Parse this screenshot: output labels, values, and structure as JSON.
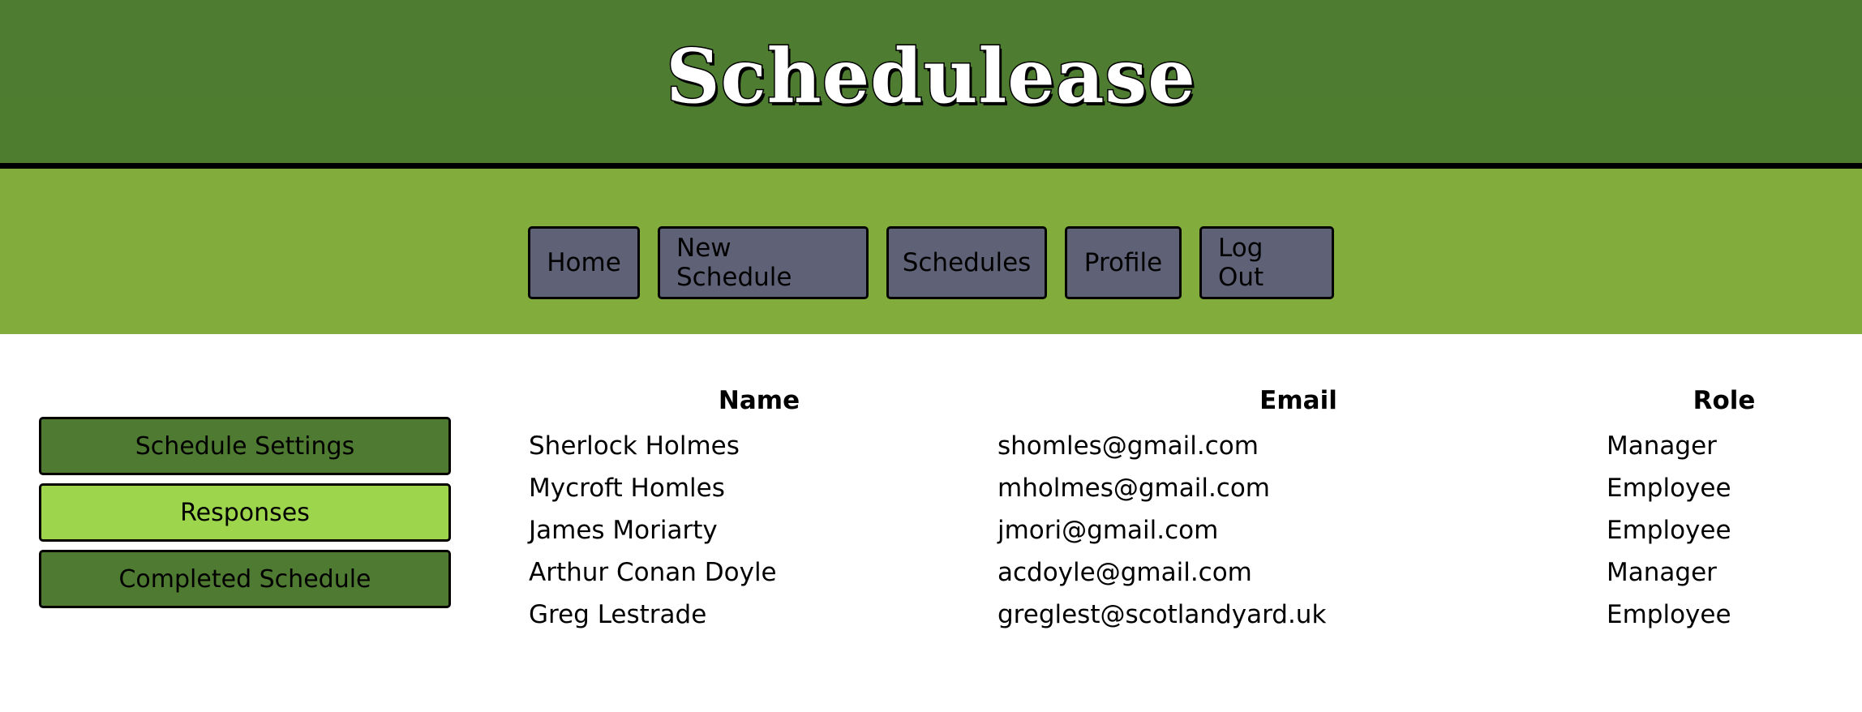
{
  "app": {
    "title": "Schedulease"
  },
  "nav": {
    "items": [
      {
        "label": "Home"
      },
      {
        "label": "New Schedule"
      },
      {
        "label": "Schedules"
      },
      {
        "label": "Profile"
      },
      {
        "label": "Log Out"
      }
    ]
  },
  "sidebar": {
    "items": [
      {
        "label": "Schedule Settings",
        "active": false
      },
      {
        "label": "Responses",
        "active": true
      },
      {
        "label": "Completed Schedule",
        "active": false
      }
    ]
  },
  "table": {
    "headers": {
      "name": "Name",
      "email": "Email",
      "role": "Role"
    },
    "rows": [
      {
        "name": "Sherlock Holmes",
        "email": "shomles@gmail.com",
        "role": "Manager"
      },
      {
        "name": "Mycroft Homles",
        "email": "mholmes@gmail.com",
        "role": "Employee"
      },
      {
        "name": "James Moriarty",
        "email": "jmori@gmail.com",
        "role": "Employee"
      },
      {
        "name": "Arthur Conan Doyle",
        "email": "acdoyle@gmail.com",
        "role": "Manager"
      },
      {
        "name": "Greg Lestrade",
        "email": "greglest@scotlandyard.uk",
        "role": "Employee"
      }
    ]
  },
  "colors": {
    "header_bg": "#4f7d30",
    "navbar_bg": "#82ad3c",
    "nav_button_bg": "#5f6277",
    "sidebar_dark": "#4f7a31",
    "sidebar_active": "#9dd64c"
  }
}
